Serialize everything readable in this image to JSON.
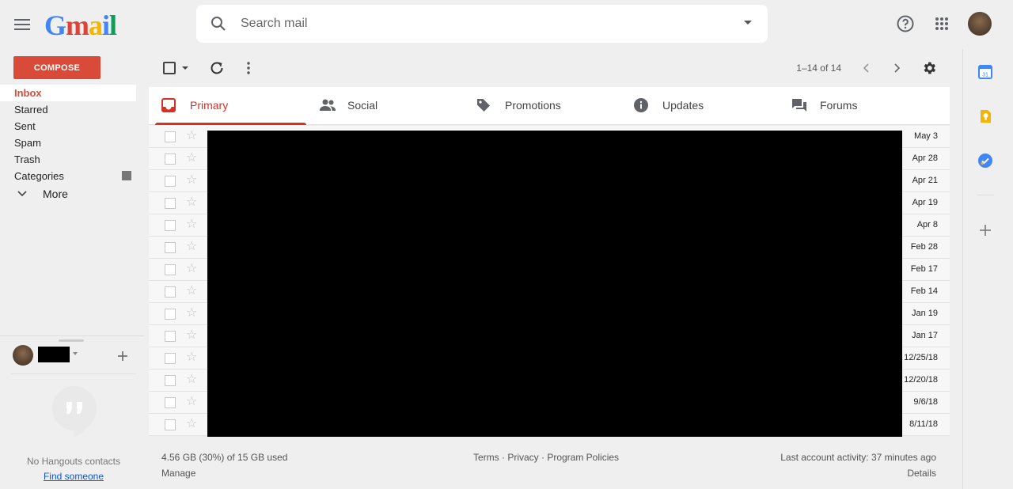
{
  "app": {
    "logo_letters": [
      "G",
      "m",
      "a",
      "i",
      "l"
    ]
  },
  "search": {
    "placeholder": "Search mail"
  },
  "compose": {
    "label": "COMPOSE"
  },
  "nav": {
    "items": [
      {
        "label": "Inbox",
        "active": true
      },
      {
        "label": "Starred"
      },
      {
        "label": "Sent"
      },
      {
        "label": "Spam"
      },
      {
        "label": "Trash"
      },
      {
        "label": "Categories"
      }
    ],
    "more_label": "More"
  },
  "toolbar": {
    "pagination": "1–14 of 14"
  },
  "tabs": [
    {
      "label": "Primary",
      "icon": "inbox-icon",
      "active": true
    },
    {
      "label": "Social",
      "icon": "people-icon"
    },
    {
      "label": "Promotions",
      "icon": "tag-icon"
    },
    {
      "label": "Updates",
      "icon": "info-icon"
    },
    {
      "label": "Forums",
      "icon": "forum-icon"
    }
  ],
  "emails": [
    {
      "date": "May 3"
    },
    {
      "date": "Apr 28"
    },
    {
      "date": "Apr 21"
    },
    {
      "date": "Apr 19"
    },
    {
      "date": "Apr 8"
    },
    {
      "date": "Feb 28"
    },
    {
      "date": "Feb 17"
    },
    {
      "date": "Feb 14"
    },
    {
      "date": "Jan 19"
    },
    {
      "date": "Jan 17"
    },
    {
      "date": "12/25/18"
    },
    {
      "date": "12/20/18"
    },
    {
      "date": "9/6/18"
    },
    {
      "date": "8/11/18"
    }
  ],
  "footer": {
    "storage": "4.56 GB (30%) of 15 GB used",
    "manage": "Manage",
    "links": "Terms · Privacy · Program Policies",
    "activity": "Last account activity: 37 minutes ago",
    "details": "Details"
  },
  "hangouts": {
    "no_contacts": "No Hangouts contacts",
    "find_someone": "Find someone"
  },
  "colors": {
    "compose": "#d94a38",
    "accent": "#d93025",
    "link": "#1155cc"
  }
}
